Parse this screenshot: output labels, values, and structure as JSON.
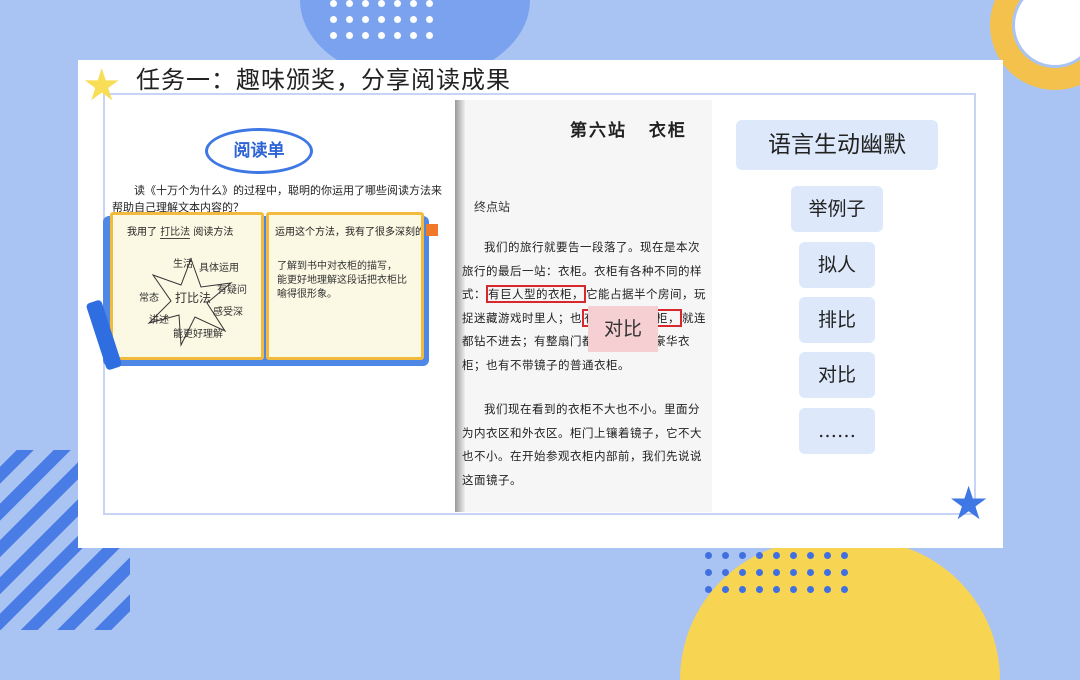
{
  "slide": {
    "title": "任务一：趣味颁奖，分享阅读成果"
  },
  "reading_sheet": {
    "heading": "阅读单",
    "question": "读《十万个为什么》的过程中，聪明的你运用了哪些阅读方法来帮助自己理解文本内容的？",
    "left_page": {
      "prefix": "我用了",
      "method_handwritten": "打比法",
      "suffix": "阅读方法",
      "map_center": "打比法",
      "map_words": [
        "生活",
        "具体运用",
        "有疑问",
        "感受深",
        "常态",
        "讲述",
        "能更好理解"
      ]
    },
    "right_page": {
      "prompt": "运用这个方法，我有了很多深刻的理",
      "handwritten_1": "了解到书中对衣柜的描写，",
      "handwritten_2": "能更好地理解这段话把衣柜比",
      "handwritten_3": "喻得很形象。"
    }
  },
  "textbook": {
    "station": "第六站",
    "location": "衣柜",
    "subtitle": "终点站",
    "para1_a": "我们的旅行就要告一段落了。现在是本次旅行的最后一站：衣柜。衣柜有各种不同的样式：",
    "para1_box1": "有巨人型的衣柜，",
    "para1_b": "它能占据半个房间，玩捉迷藏游戏时里",
    "para1_c": "人；也",
    "para1_box2": "有侏儒型的衣柜，",
    "para1_d": "就连",
    "para1_e": "都钻不进去；有整扇门都是大镜子的豪华衣柜；也有不带镜子的普通衣柜。",
    "para2": "我们现在看到的衣柜不大也不小。里面分为内衣区和外衣区。柜门上镶着镜子，它不大也不小。在开始参观衣柜内部前，我们先说说这面镜子。",
    "compare_label": "对比"
  },
  "techniques": {
    "main": "语言生动幽默",
    "items": [
      "举例子",
      "拟人",
      "排比",
      "对比",
      "……"
    ]
  },
  "colors": {
    "accent_blue": "#3f78e4",
    "highlight_red": "#d8282e",
    "pill_bg": "#dde9fb",
    "compare_bg": "#f5cfd2"
  }
}
